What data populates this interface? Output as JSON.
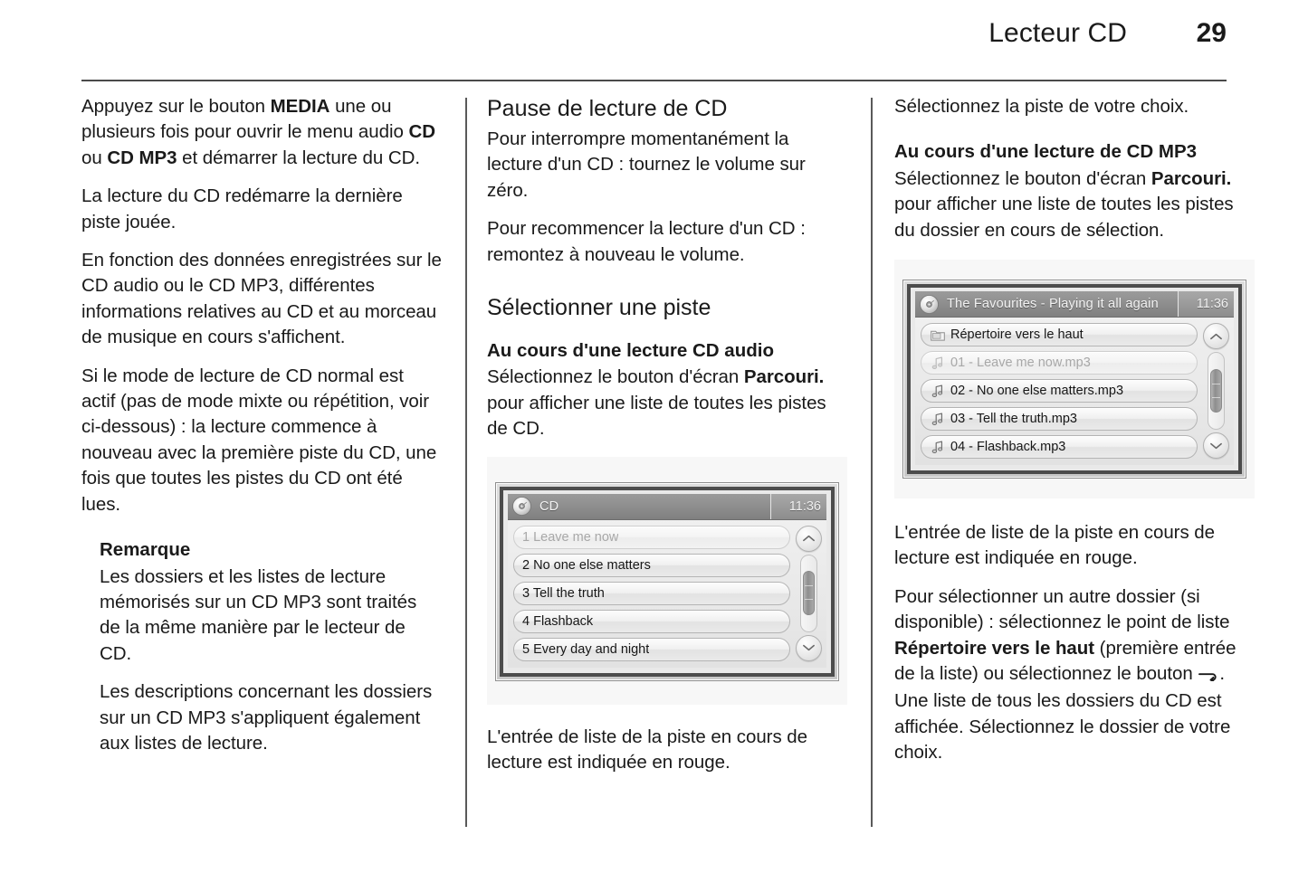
{
  "header": {
    "title": "Lecteur CD",
    "page_number": "29"
  },
  "column1": {
    "p1_prefix": "Appuyez sur le bouton ",
    "p1_b1": "MEDIA",
    "p1_mid1": " une ou plusieurs fois pour ouvrir le menu audio ",
    "p1_b2": "CD",
    "p1_mid2": " ou ",
    "p1_b3": "CD MP3",
    "p1_suffix": " et démarrer la lecture du CD.",
    "p2": "La lecture du CD redémarre la dernière piste jouée.",
    "p3": "En fonction des données enregistrées sur le CD audio ou le CD MP3, différentes informations relatives au CD et au morceau de musique en cours s'affichent.",
    "p4": "Si le mode de lecture de CD normal est actif (pas de mode mixte ou répétition, voir ci-dessous) : la lecture commence à nouveau avec la première piste du CD, une fois que toutes les pistes du CD ont été lues.",
    "note_title": "Remarque",
    "note_p1": "Les dossiers et les listes de lecture mémorisés sur un CD MP3 sont traités de la même manière par le lecteur de CD.",
    "note_p2": "Les descriptions concernant les dossiers sur un CD MP3 s'appliquent également aux listes de lecture."
  },
  "column2": {
    "heading1": "Pause de lecture de CD",
    "p1": "Pour interrompre momentanément la lecture d'un CD : tournez le volume sur zéro.",
    "p2": "Pour recommencer la lecture d'un CD : remontez à nouveau le volume.",
    "heading2": "Sélectionner une piste",
    "subheading1": "Au cours d'une lecture CD audio",
    "p3_prefix": "Sélectionnez le bouton d'écran ",
    "p3_bold": "Parcouri.",
    "p3_suffix": " pour afficher une liste de toutes les pistes de CD.",
    "p4": "L'entrée de liste de la piste en cours de lecture est indiquée en rouge.",
    "figure": {
      "icon": "cd-disc-icon",
      "title": "CD",
      "time": "11:36",
      "rows": [
        {
          "label": "1 Leave me now",
          "icon": null,
          "playing": true
        },
        {
          "label": "2 No one else matters",
          "icon": null,
          "playing": false
        },
        {
          "label": "3 Tell the truth",
          "icon": null,
          "playing": false
        },
        {
          "label": "4 Flashback",
          "icon": null,
          "playing": false
        },
        {
          "label": "5 Every day and night",
          "icon": null,
          "playing": false
        }
      ]
    }
  },
  "column3": {
    "p1": "Sélectionnez la piste de votre choix.",
    "subheading1": "Au cours d'une lecture de CD MP3",
    "p2_prefix": "Sélectionnez le bouton d'écran ",
    "p2_bold": "Parcouri.",
    "p2_suffix": " pour afficher une liste de toutes les pistes du dossier en cours de sélection.",
    "p3": "L'entrée de liste de la piste en cours de lecture est indiquée en rouge.",
    "p4_prefix": "Pour sélectionner un autre dossier (si disponible) : sélectionnez le point de liste ",
    "p4_bold": "Répertoire vers le haut",
    "p4_mid": " (première entrée de la liste) ou sélectionnez le bouton ",
    "p4_glyph": "back-arrow-icon",
    "p4_suffix": ". Une liste de tous les dossiers du CD est affichée. Sélectionnez le dossier de votre choix.",
    "figure": {
      "icon": "cd-disc-icon",
      "title": "The Favourites - Playing it all again",
      "time": "11:36",
      "rows": [
        {
          "label": "Répertoire vers le haut",
          "icon": "folder-icon",
          "playing": false
        },
        {
          "label": "01 - Leave me now.mp3",
          "icon": "music-note-icon",
          "playing": true
        },
        {
          "label": "02 - No one else matters.mp3",
          "icon": "music-note-icon",
          "playing": false
        },
        {
          "label": "03 - Tell the truth.mp3",
          "icon": "music-note-icon",
          "playing": false
        },
        {
          "label": "04 - Flashback.mp3",
          "icon": "music-note-icon",
          "playing": false
        }
      ]
    }
  },
  "colors": {
    "text": "#1a1a1a",
    "rule": "#4a4a4a",
    "figure_panel_bg": "#f7f7f7",
    "titlebar": "#8d8d8d"
  }
}
